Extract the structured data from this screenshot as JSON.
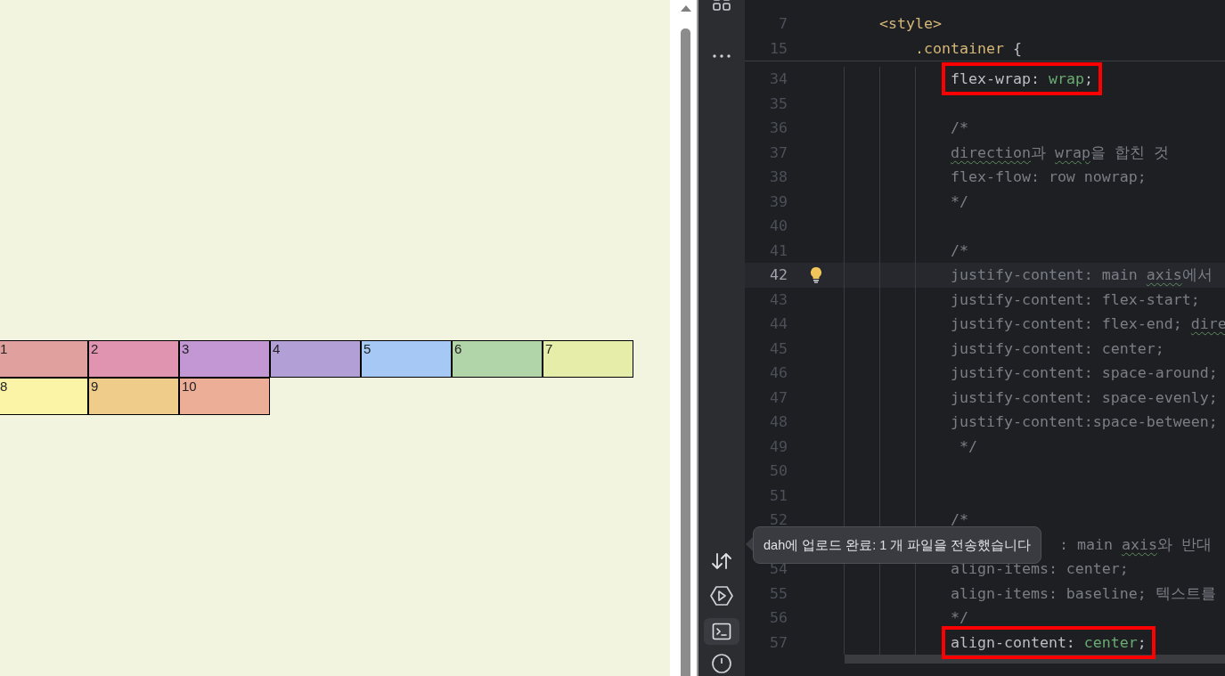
{
  "preview": {
    "boxes": [
      {
        "label": "1",
        "color": "#dfa09e"
      },
      {
        "label": "2",
        "color": "#e094b0"
      },
      {
        "label": "3",
        "color": "#c396d4"
      },
      {
        "label": "4",
        "color": "#b19fd6"
      },
      {
        "label": "5",
        "color": "#a6c8f4"
      },
      {
        "label": "6",
        "color": "#b1d4a9"
      },
      {
        "label": "7",
        "color": "#e5eda9"
      },
      {
        "label": "8",
        "color": "#fbf3a6"
      },
      {
        "label": "9",
        "color": "#f0cc8a"
      },
      {
        "label": "10",
        "color": "#edae98"
      }
    ]
  },
  "tool_strip": [
    {
      "selected": false
    },
    {
      "selected": false
    },
    {
      "selected": false
    },
    {
      "selected": false
    },
    {
      "selected": true
    },
    {
      "selected": false
    }
  ],
  "editor": {
    "sticky_lines": [
      {
        "number": "7",
        "segments": [
          {
            "text": "<style>",
            "kind": "tag"
          }
        ]
      },
      {
        "number": "15",
        "segments": [
          {
            "text": ".container",
            "kind": "selector"
          },
          {
            "text": " {",
            "kind": "punct"
          }
        ]
      }
    ],
    "lines": [
      {
        "number": "34",
        "current": false,
        "boxed": true,
        "segments": [
          {
            "text": "flex-wrap: ",
            "kind": "prop"
          },
          {
            "text": "wrap",
            "kind": "value"
          },
          {
            "text": ";",
            "kind": "prop"
          }
        ]
      },
      {
        "number": "35",
        "current": false,
        "boxed": false
      },
      {
        "number": "36",
        "current": false,
        "boxed": false,
        "segments": [
          {
            "text": "/*",
            "kind": "comment"
          }
        ]
      },
      {
        "number": "37",
        "current": false,
        "boxed": false,
        "segments": [
          {
            "text": "direction",
            "kind": "flagged"
          },
          {
            "text": "과 ",
            "kind": "comment"
          },
          {
            "text": "wrap",
            "kind": "flagged"
          },
          {
            "text": "을 합친 것",
            "kind": "comment"
          }
        ]
      },
      {
        "number": "38",
        "current": false,
        "boxed": false,
        "segments": [
          {
            "text": "flex-flow: row nowrap;",
            "kind": "comment"
          }
        ]
      },
      {
        "number": "39",
        "current": false,
        "boxed": false,
        "segments": [
          {
            "text": "*/",
            "kind": "comment"
          }
        ]
      },
      {
        "number": "40",
        "current": false,
        "boxed": false
      },
      {
        "number": "41",
        "current": false,
        "boxed": false,
        "segments": [
          {
            "text": "/*",
            "kind": "comment"
          }
        ]
      },
      {
        "number": "42",
        "current": true,
        "boxed": false,
        "segments": [
          {
            "text": "justify-content: main ",
            "kind": "comment"
          },
          {
            "text": "axis",
            "kind": "flagged"
          },
          {
            "text": "에서",
            "kind": "comment"
          }
        ]
      },
      {
        "number": "43",
        "current": false,
        "boxed": false,
        "segments": [
          {
            "text": "justify-content: flex-start;",
            "kind": "comment"
          }
        ]
      },
      {
        "number": "44",
        "current": false,
        "boxed": false,
        "segments": [
          {
            "text": "justify-content: flex-end; ",
            "kind": "comment"
          },
          {
            "text": "dire",
            "kind": "flagged"
          }
        ]
      },
      {
        "number": "45",
        "current": false,
        "boxed": false,
        "segments": [
          {
            "text": "justify-content: center;",
            "kind": "comment"
          }
        ]
      },
      {
        "number": "46",
        "current": false,
        "boxed": false,
        "segments": [
          {
            "text": "justify-content: space-around;",
            "kind": "comment"
          }
        ]
      },
      {
        "number": "47",
        "current": false,
        "boxed": false,
        "segments": [
          {
            "text": "justify-content: space-evenly;",
            "kind": "comment"
          }
        ]
      },
      {
        "number": "48",
        "current": false,
        "boxed": false,
        "segments": [
          {
            "text": "justify-content:space-between;",
            "kind": "comment"
          }
        ]
      },
      {
        "number": "49",
        "current": false,
        "boxed": false,
        "segments": [
          {
            "text": " */",
            "kind": "comment"
          }
        ]
      },
      {
        "number": "50",
        "current": false,
        "boxed": false
      },
      {
        "number": "51",
        "current": false,
        "boxed": false
      },
      {
        "number": "52",
        "current": false,
        "boxed": false,
        "segments": [
          {
            "text": "/*",
            "kind": "comment"
          }
        ]
      },
      {
        "current": false,
        "boxed": false,
        "segments": [
          {
            "text": ": main ",
            "kind": "comment"
          },
          {
            "text": "axis",
            "kind": "flagged"
          },
          {
            "text": "와 반대",
            "kind": "comment"
          }
        ]
      },
      {
        "number": "54",
        "current": false,
        "boxed": false,
        "segments": [
          {
            "text": "align-items: center;",
            "kind": "comment"
          }
        ]
      },
      {
        "number": "55",
        "current": false,
        "boxed": false,
        "segments": [
          {
            "text": "align-items: baseline; 텍스트를",
            "kind": "comment"
          }
        ]
      },
      {
        "number": "56",
        "current": false,
        "boxed": false,
        "segments": [
          {
            "text": "*/",
            "kind": "comment"
          }
        ]
      },
      {
        "number": "57",
        "current": false,
        "boxed": true,
        "segments": [
          {
            "text": "align-content: ",
            "kind": "prop"
          },
          {
            "text": "center",
            "kind": "value"
          },
          {
            "text": ";",
            "kind": "prop"
          }
        ]
      }
    ]
  },
  "tooltip": {
    "text": "dah에 업로드 완료: 1 개 파일을 전송했습니다"
  }
}
